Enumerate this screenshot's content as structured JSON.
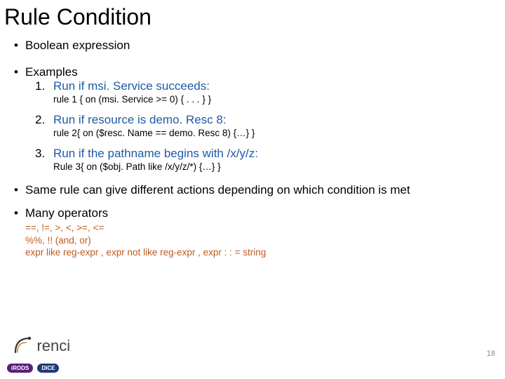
{
  "title": "Rule Condition",
  "bullets": {
    "boolean": "Boolean expression",
    "examplesLabel": "Examples",
    "examples": [
      {
        "title": "Run if msi. Service succeeds:",
        "code": "rule 1 { on (msi. Service >= 0) { . . . } }"
      },
      {
        "title": "Run if resource is demo. Resc 8:",
        "code": "rule 2{ on ($resc. Name == demo. Resc 8) {…} }"
      },
      {
        "title": "Run if the pathname begins with /x/y/z:",
        "code": "Rule 3{ on ($obj. Path like /x/y/z/*) {…} }"
      }
    ],
    "sameRule": "Same rule can give different actions depending on which condition is met",
    "manyOps": "Many operators",
    "operators": {
      "line1": "==,  !=, >, <, >=, <=",
      "line2": "%%,  !!   (and, or)",
      "line3": "expr like reg-expr , expr not like reg-expr , expr : : = string"
    }
  },
  "footer": {
    "pageNumber": "18",
    "renci": "renci",
    "irods": "iRODS",
    "dice": "DICE"
  }
}
